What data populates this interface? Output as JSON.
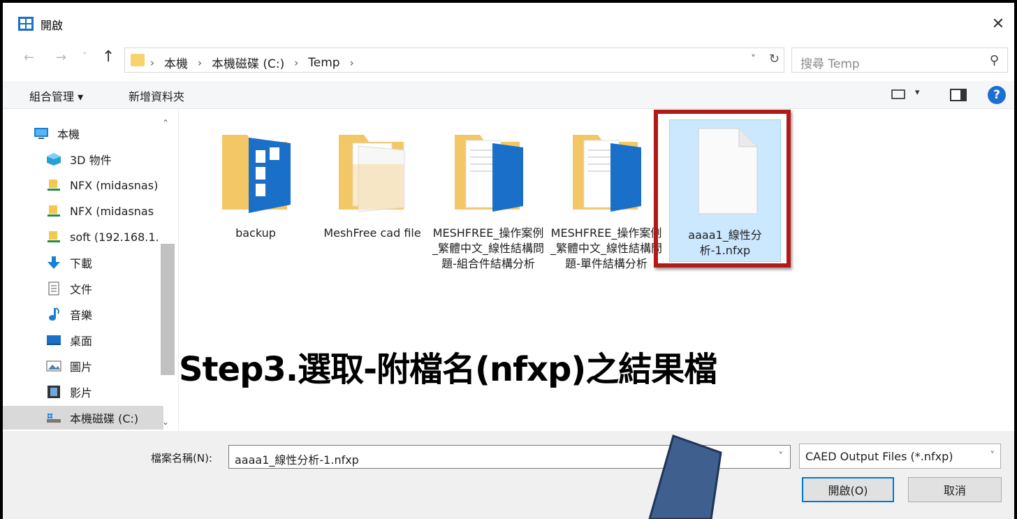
{
  "window": {
    "title": "開啟",
    "close_glyph": "✕"
  },
  "navigation": {
    "back_glyph": "←",
    "forward_glyph": "→",
    "recent_glyph": "˅",
    "up_glyph": "↑",
    "breadcrumbs": [
      "本機",
      "本機磁碟 (C:)",
      "Temp"
    ],
    "crumb_separator": "›",
    "dropdown_glyph": "˅",
    "refresh_glyph": "↻",
    "search_placeholder": "搜尋 Temp",
    "search_glyph": "⚲"
  },
  "toolbar": {
    "organize_label": "組合管理 ▾",
    "new_folder_label": "新增資料夾",
    "view_dropdown_glyph": "▾",
    "help_glyph": "?"
  },
  "sidebar": {
    "items": [
      {
        "label": "本機",
        "icon": "computer-icon"
      },
      {
        "label": "3D 物件",
        "icon": "3d-objects-icon"
      },
      {
        "label": "NFX (midasnas)",
        "icon": "network-drive-icon"
      },
      {
        "label": "NFX (midasnas",
        "icon": "network-drive-icon"
      },
      {
        "label": "soft (192.168.1.",
        "icon": "network-drive-icon"
      },
      {
        "label": "下載",
        "icon": "download-icon"
      },
      {
        "label": "文件",
        "icon": "document-icon"
      },
      {
        "label": "音樂",
        "icon": "music-icon"
      },
      {
        "label": "桌面",
        "icon": "desktop-icon"
      },
      {
        "label": "圖片",
        "icon": "pictures-icon"
      },
      {
        "label": "影片",
        "icon": "videos-icon"
      },
      {
        "label": "本機磁碟 (C:)",
        "icon": "local-disk-icon"
      }
    ],
    "selected_index": 11
  },
  "files": [
    {
      "label": "backup",
      "type": "folder"
    },
    {
      "label": "MeshFree cad file",
      "type": "folder"
    },
    {
      "label": "MESHFREE_操作案例_繁體中文_線性結構問題-組合件結構分析",
      "type": "folder"
    },
    {
      "label": "MESHFREE_操作案例_繁體中文_線性結構問題-單件結構分析",
      "type": "folder"
    },
    {
      "label": "aaaa1_線性分析-1.nfxp",
      "type": "file",
      "selected": true
    }
  ],
  "annotation": "Step3.選取-附檔名(nfxp)之結果檔",
  "footer": {
    "filename_label": "檔案名稱(N):",
    "filename_value": "aaaa1_線性分析-1.nfxp",
    "filetype_value": "CAED Output Files (*.nfxp)",
    "dropdown_glyph": "˅",
    "open_button": "開啟(O)",
    "cancel_button": "取消"
  },
  "colors": {
    "highlight_border": "#b21a1a",
    "selection_fill": "#cce8ff",
    "arrow_fill": "#3f5f8f",
    "accent": "#0078d7"
  }
}
